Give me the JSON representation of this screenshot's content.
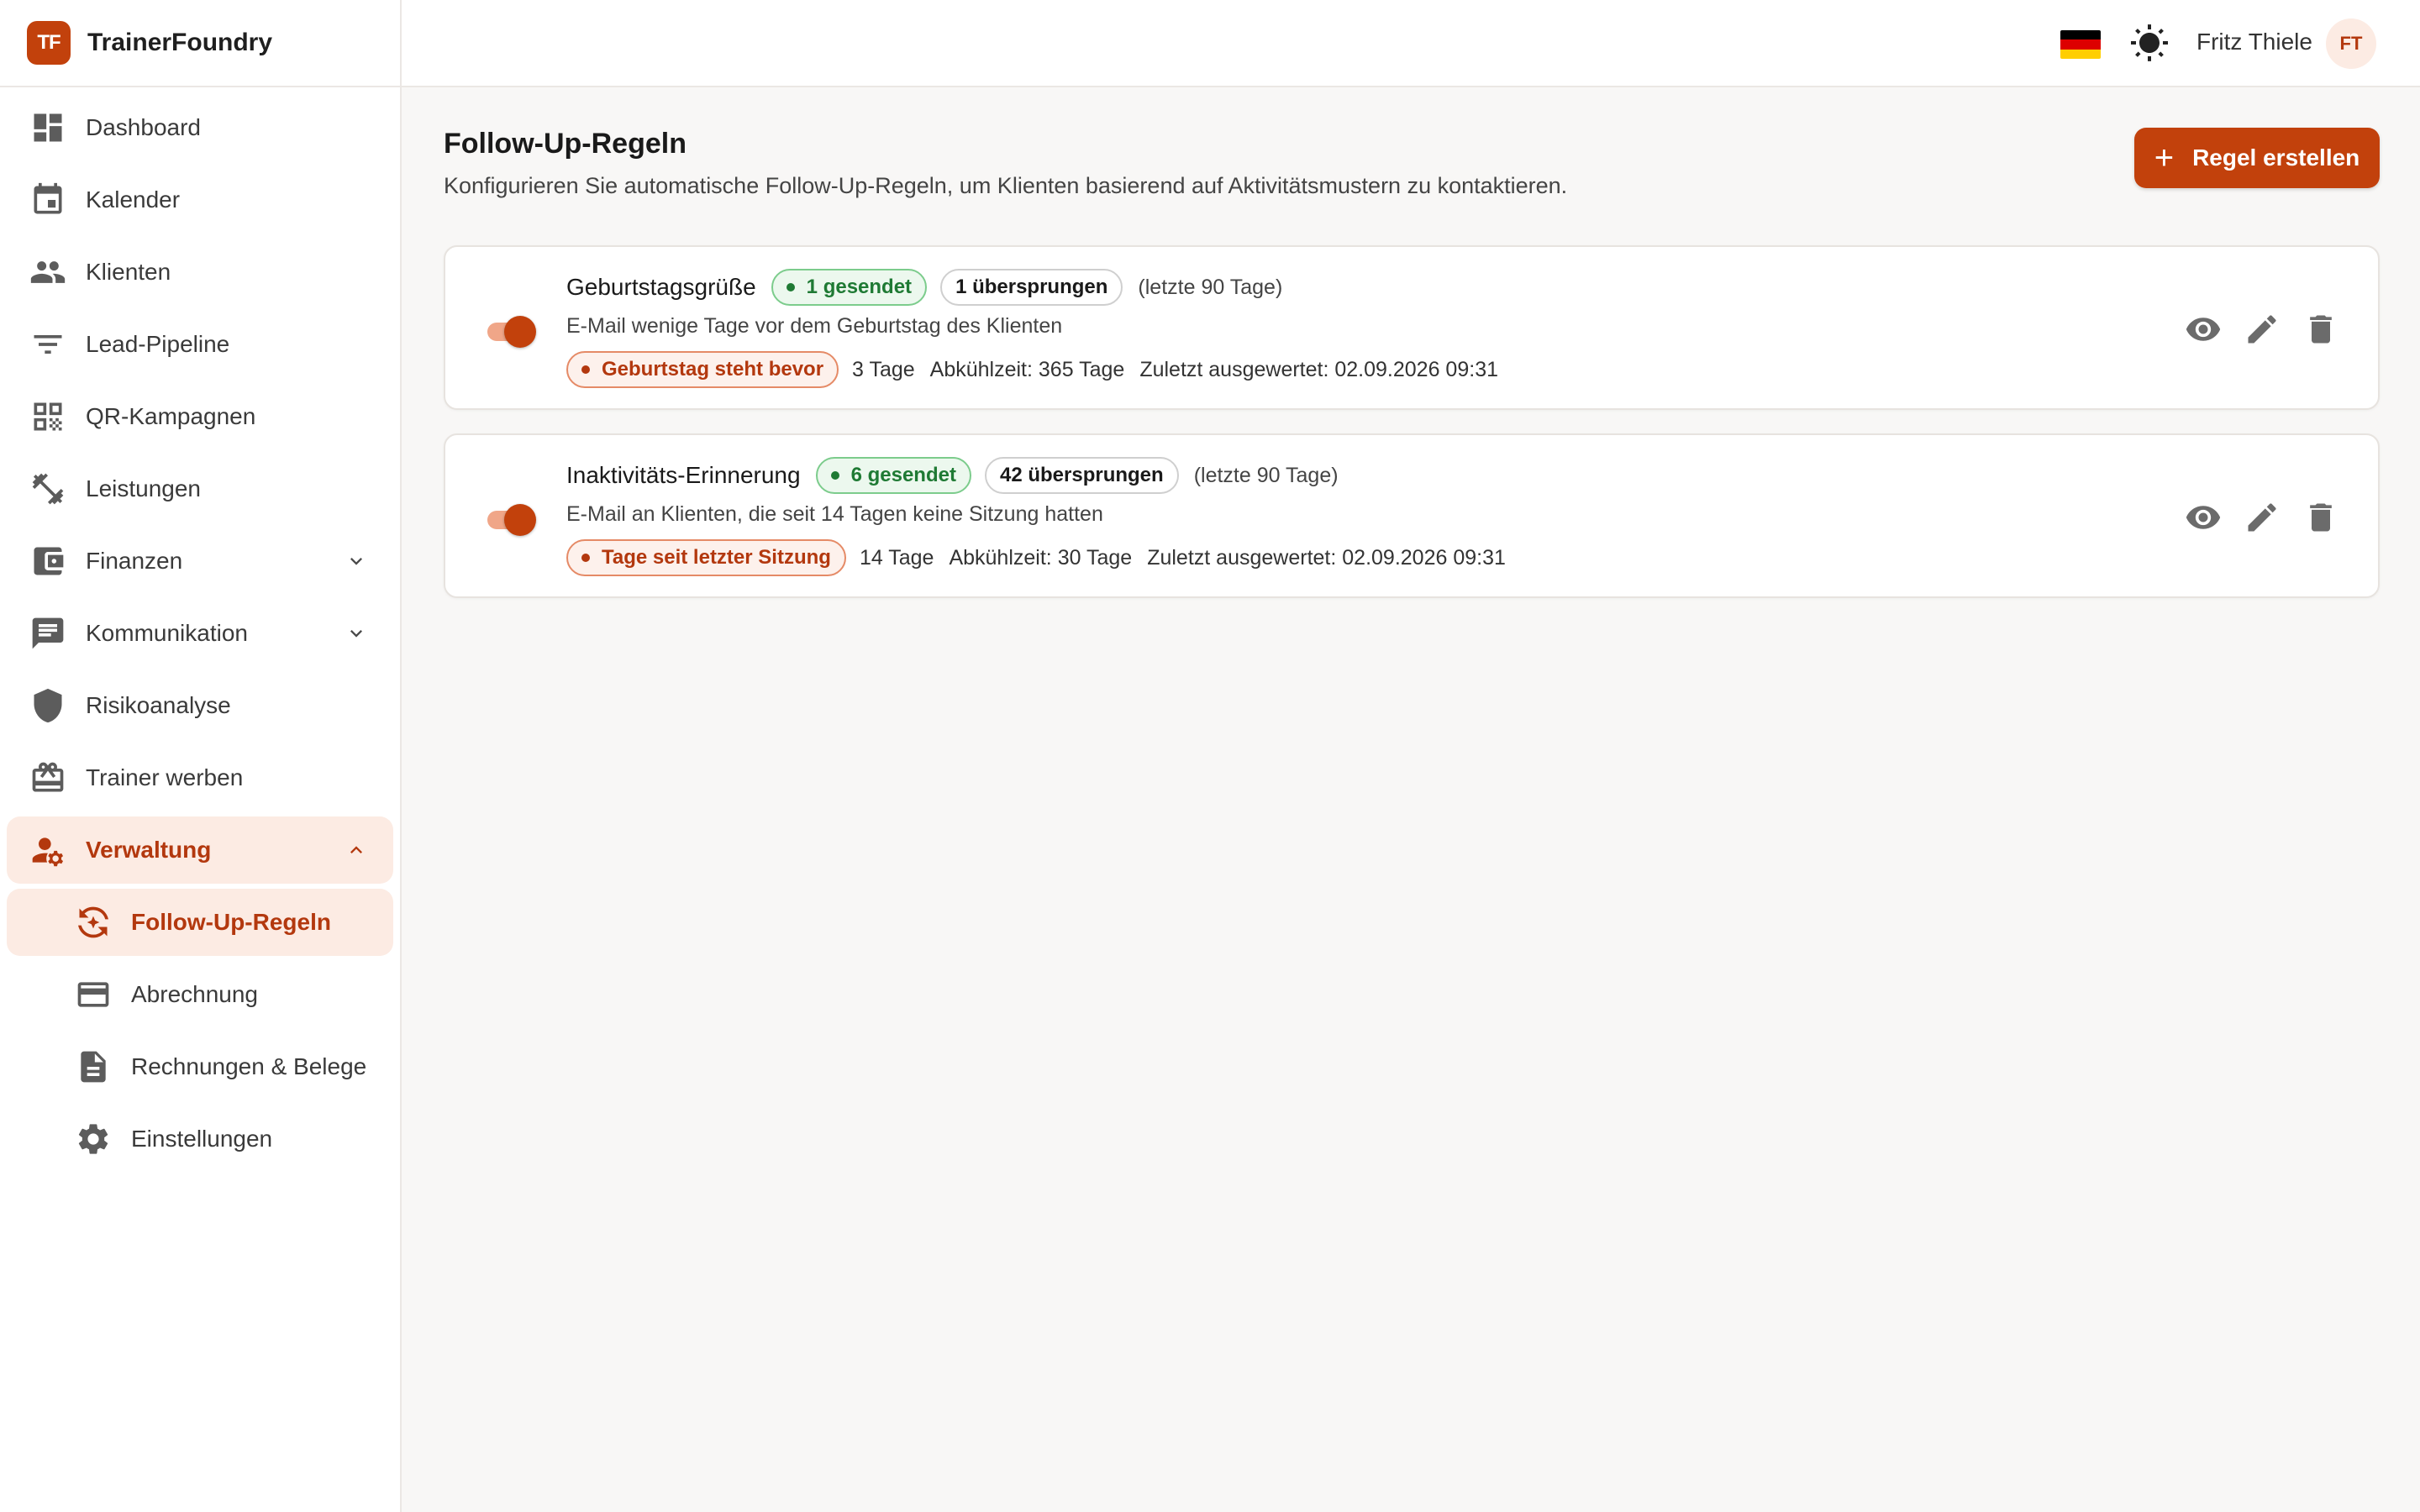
{
  "brand": {
    "logo_text": "TF",
    "name": "TrainerFoundry",
    "accent": "#c2410c"
  },
  "sidebar": {
    "items": [
      {
        "label": "Dashboard",
        "icon": "dashboard-icon"
      },
      {
        "label": "Kalender",
        "icon": "calendar-icon"
      },
      {
        "label": "Klienten",
        "icon": "people-icon"
      },
      {
        "label": "Lead-Pipeline",
        "icon": "filter-icon"
      },
      {
        "label": "QR-Kampagnen",
        "icon": "qr-code-icon"
      },
      {
        "label": "Leistungen",
        "icon": "dumbbell-icon"
      },
      {
        "label": "Finanzen",
        "icon": "wallet-icon",
        "expandable": true
      },
      {
        "label": "Kommunikation",
        "icon": "chat-icon",
        "expandable": true
      },
      {
        "label": "Risikoanalyse",
        "icon": "shield-icon"
      },
      {
        "label": "Trainer werben",
        "icon": "gift-card-icon"
      },
      {
        "label": "Verwaltung",
        "icon": "admin-icon",
        "expandable": true,
        "expanded": true,
        "active": true
      },
      {
        "label": "Follow-Up-Regeln",
        "icon": "follow-up-icon",
        "sub": true,
        "active": true
      },
      {
        "label": "Abrechnung",
        "icon": "credit-card-icon",
        "sub": true
      },
      {
        "label": "Rechnungen & Belege",
        "icon": "document-icon",
        "sub": true
      },
      {
        "label": "Einstellungen",
        "icon": "gear-icon",
        "sub": true
      }
    ]
  },
  "header": {
    "language_flag": "germany-flag-icon",
    "theme_icon": "sun-icon",
    "user_name": "Fritz Thiele",
    "user_initials": "FT"
  },
  "page": {
    "title": "Follow-Up-Regeln",
    "subtitle": "Konfigurieren Sie automatische Follow-Up-Regeln, um Klienten basierend auf Aktivitätsmustern zu kontaktieren.",
    "create_button": "Regel erstellen"
  },
  "rules": [
    {
      "enabled": true,
      "name": "Geburtstagsgrüße",
      "sent": "1 gesendet",
      "skipped": "1 übersprungen",
      "period": "(letzte 90 Tage)",
      "description": "E-Mail wenige Tage vor dem Geburtstag des Klienten",
      "trigger": "Geburtstag steht bevor",
      "days": "3 Tage",
      "cooldown": "Abkühlzeit: 365 Tage",
      "evaluated": "Zuletzt ausgewertet: 02.09.2026 09:31"
    },
    {
      "enabled": true,
      "name": "Inaktivitäts-Erinnerung",
      "sent": "6 gesendet",
      "skipped": "42 übersprungen",
      "period": "(letzte 90 Tage)",
      "description": "E-Mail an Klienten, die seit 14 Tagen keine Sitzung hatten",
      "trigger": "Tage seit letzter Sitzung",
      "days": "14 Tage",
      "cooldown": "Abkühlzeit: 30 Tage",
      "evaluated": "Zuletzt ausgewertet: 02.09.2026 09:31"
    }
  ],
  "colors": {
    "accent": "#c2410c",
    "active_bg": "#fcebe3",
    "success": "#1f7a34",
    "background": "#f8f7f6"
  }
}
